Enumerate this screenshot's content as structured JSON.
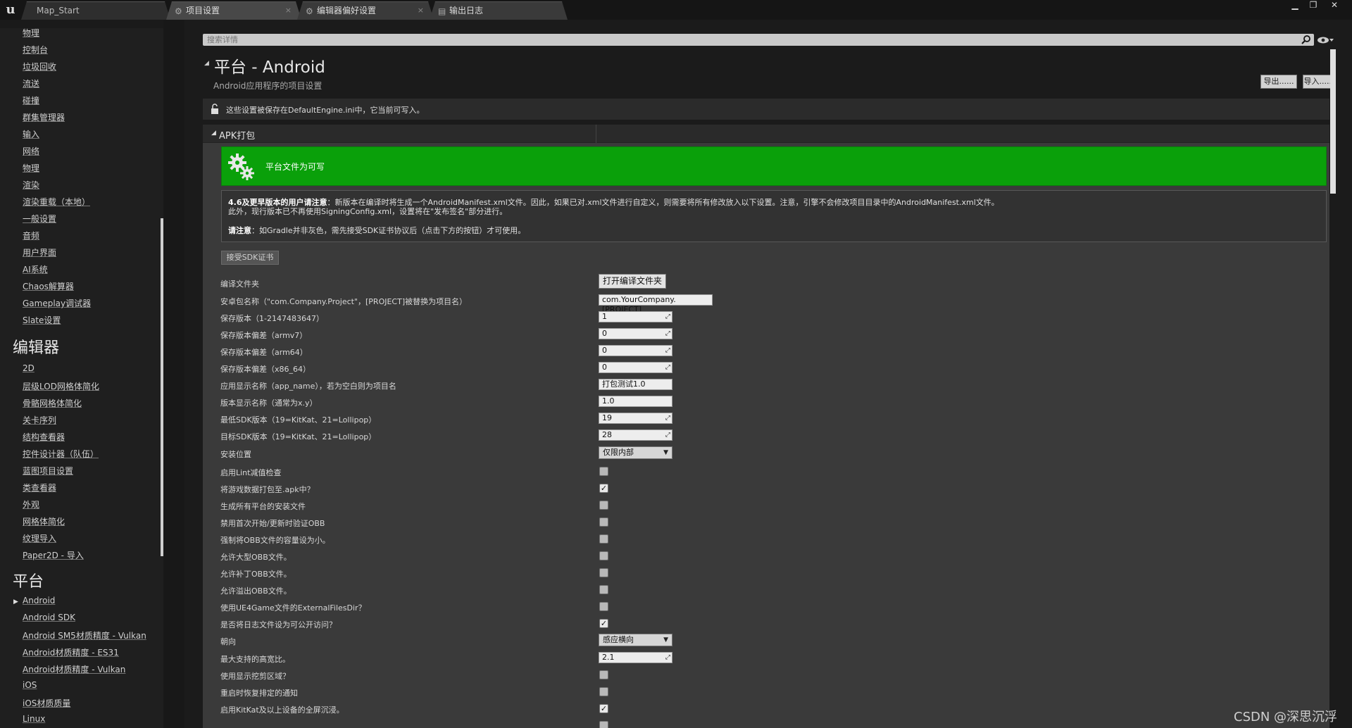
{
  "window": {
    "tabs": [
      {
        "label": "Map_Start"
      },
      {
        "label": "项目设置"
      },
      {
        "label": "编辑器偏好设置"
      },
      {
        "label": "输出日志"
      }
    ],
    "close_glyph": "×"
  },
  "sidebar": {
    "items_top": [
      "物理",
      "控制台",
      "垃圾回收",
      "流送",
      "碰撞",
      "群集管理器",
      "输入",
      "网络",
      "物理",
      "渲染",
      "渲染重载（本地）",
      "一般设置",
      "音频",
      "用户界面",
      "AI系统",
      "Chaos解算器",
      "Gameplay调试器",
      "Slate设置"
    ],
    "heading_editor": "编辑器",
    "items_editor": [
      "2D",
      "层级LOD网格体简化",
      "骨骼网格体简化",
      "关卡序列",
      "结构查看器",
      "控件设计器（队伍）",
      "蓝图项目设置",
      "类查看器",
      "外观",
      "网格体简化",
      "纹理导入",
      "Paper2D - 导入"
    ],
    "heading_platform": "平台",
    "items_platform": [
      "Android",
      "Android SDK",
      "Android SM5材质精度 - Vulkan",
      "Android材质精度 - ES31",
      "Android材质精度 - Vulkan",
      "iOS",
      "iOS材质质量",
      "Linux"
    ],
    "selected_platform": "Android"
  },
  "search": {
    "placeholder": "搜索详情"
  },
  "header": {
    "title": "平台 - Android",
    "subtitle": "Android应用程序的项目设置",
    "export_label": "导出......",
    "import_label": "导入......"
  },
  "notice": {
    "text": "这些设置被保存在DefaultEngine.ini中，它当前可写入。"
  },
  "section": {
    "title": "APK打包"
  },
  "banner": {
    "text": "平台文件为可写"
  },
  "info": {
    "line1_bold": "4.6及更早版本的用户请注意",
    "line1_rest": "：新版本在编译时将生成一个AndroidManifest.xml文件。因此，如果已对.xml文件进行自定义，则需要将所有修改放入以下设置。注意，引擎不会修改项目目录中的AndroidManifest.xml文件。",
    "line2": "此外，现行版本已不再使用SigningConfig.xml，设置将在\"发布签名\"部分进行。",
    "line3_bold": "请注意",
    "line3_rest": "：如Gradle并非灰色，需先接受SDK证书协议后（点击下方的按钮）才可使用。"
  },
  "accept_sdk_label": "接受SDK证书",
  "rows": [
    {
      "label": "编译文件夹",
      "type": "button",
      "value": "打开编译文件夹"
    },
    {
      "label": "安卓包名称（\"com.Company.Project\"，[PROJECT]被替换为项目名）",
      "type": "text",
      "value": "com.YourCompany.[PROJECT]"
    },
    {
      "label": "保存版本（1-2147483647）",
      "type": "num",
      "value": "1"
    },
    {
      "label": "保存版本偏差（armv7）",
      "type": "num",
      "value": "0"
    },
    {
      "label": "保存版本偏差（arm64）",
      "type": "num",
      "value": "0"
    },
    {
      "label": "保存版本偏差（x86_64）",
      "type": "num",
      "value": "0"
    },
    {
      "label": "应用显示名称（app_name），若为空白则为项目名",
      "type": "text",
      "value": "打包测试1.0"
    },
    {
      "label": "版本显示名称（通常为x.y）",
      "type": "text",
      "value": "1.0"
    },
    {
      "label": "最低SDK版本（19=KitKat、21=Lollipop）",
      "type": "num",
      "value": "19"
    },
    {
      "label": "目标SDK版本（19=KitKat、21=Lollipop）",
      "type": "num",
      "value": "28"
    },
    {
      "label": "安装位置",
      "type": "combo",
      "value": "仅限内部"
    },
    {
      "label": "启用Lint减值检查",
      "type": "check",
      "checked": false
    },
    {
      "label": "将游戏数据打包至.apk中？",
      "type": "check",
      "checked": true
    },
    {
      "label": "生成所有平台的安装文件",
      "type": "check",
      "checked": false
    },
    {
      "label": "禁用首次开始/更新时验证OBB",
      "type": "check",
      "checked": false
    },
    {
      "label": "强制将OBB文件的容量设为小。",
      "type": "check",
      "checked": false
    },
    {
      "label": "允许大型OBB文件。",
      "type": "check",
      "checked": false
    },
    {
      "label": "允许补丁OBB文件。",
      "type": "check",
      "checked": false
    },
    {
      "label": "允许溢出OBB文件。",
      "type": "check",
      "checked": false
    },
    {
      "label": "使用UE4Game文件的ExternalFilesDir？",
      "type": "check",
      "checked": false
    },
    {
      "label": "是否将日志文件设为可公开访问？",
      "type": "check",
      "checked": true
    },
    {
      "label": "朝向",
      "type": "combo",
      "value": "感应横向"
    },
    {
      "label": "最大支持的高宽比。",
      "type": "num",
      "value": "2.1"
    },
    {
      "label": "使用显示挖剪区域？",
      "type": "check",
      "checked": false
    },
    {
      "label": "重启时恢复排定的通知",
      "type": "check",
      "checked": false
    },
    {
      "label": "启用KitKat及以上设备的全屏沉浸。",
      "type": "check",
      "checked": true
    },
    {
      "label": "",
      "type": "check",
      "checked": false
    }
  ],
  "check_glyph": "✓",
  "watermark": "CSDN @深思沉浮"
}
